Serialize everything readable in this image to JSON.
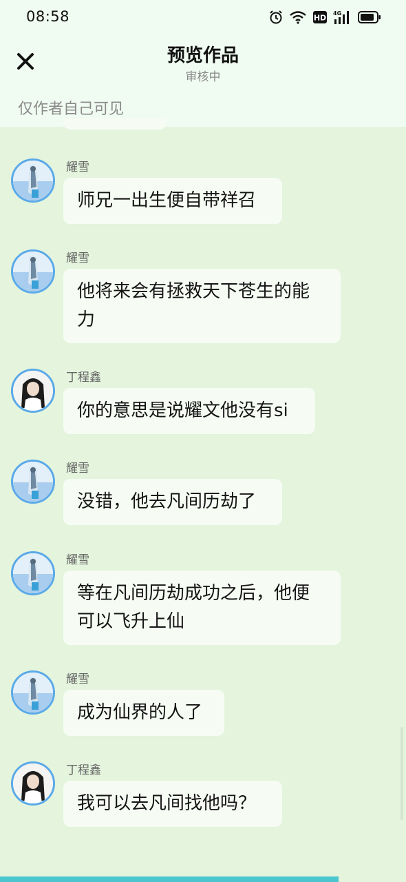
{
  "status_bar": {
    "time": "08:58",
    "icons": [
      "alarm-icon",
      "wifi-icon",
      "hd-icon",
      "signal-4g-icon",
      "battery-icon"
    ],
    "hd_label": "HD",
    "network_label": "4G"
  },
  "header": {
    "title": "预览作品",
    "subtitle": "审核中",
    "visibility_note": "仅作者自己可见",
    "close_icon": "close-icon"
  },
  "colors": {
    "background": "#e4f4dd",
    "header_background": "#f0fbf1",
    "bubble": "#f6fcf3",
    "avatar_ring": "#5aa9e8",
    "accent_bar": "#49c6d0"
  },
  "messages": [
    {
      "speaker": "耀雪",
      "avatar": "yaoxue-avatar",
      "lines": [
        "师兄一出生便自带祥召"
      ]
    },
    {
      "speaker": "耀雪",
      "avatar": "yaoxue-avatar",
      "lines": [
        "他将来会有拯救天下苍生的能",
        "力"
      ]
    },
    {
      "speaker": "丁程鑫",
      "avatar": "dingchengxin-avatar",
      "lines": [
        "你的意思是说耀文他没有si"
      ]
    },
    {
      "speaker": "耀雪",
      "avatar": "yaoxue-avatar",
      "lines": [
        "没错，他去凡间历劫了"
      ]
    },
    {
      "speaker": "耀雪",
      "avatar": "yaoxue-avatar",
      "lines": [
        "等在凡间历劫成功之后，他便",
        "可以飞升上仙"
      ]
    },
    {
      "speaker": "耀雪",
      "avatar": "yaoxue-avatar",
      "lines": [
        "成为仙界的人了"
      ]
    },
    {
      "speaker": "丁程鑫",
      "avatar": "dingchengxin-avatar",
      "lines": [
        "我可以去凡间找他吗？"
      ]
    }
  ]
}
